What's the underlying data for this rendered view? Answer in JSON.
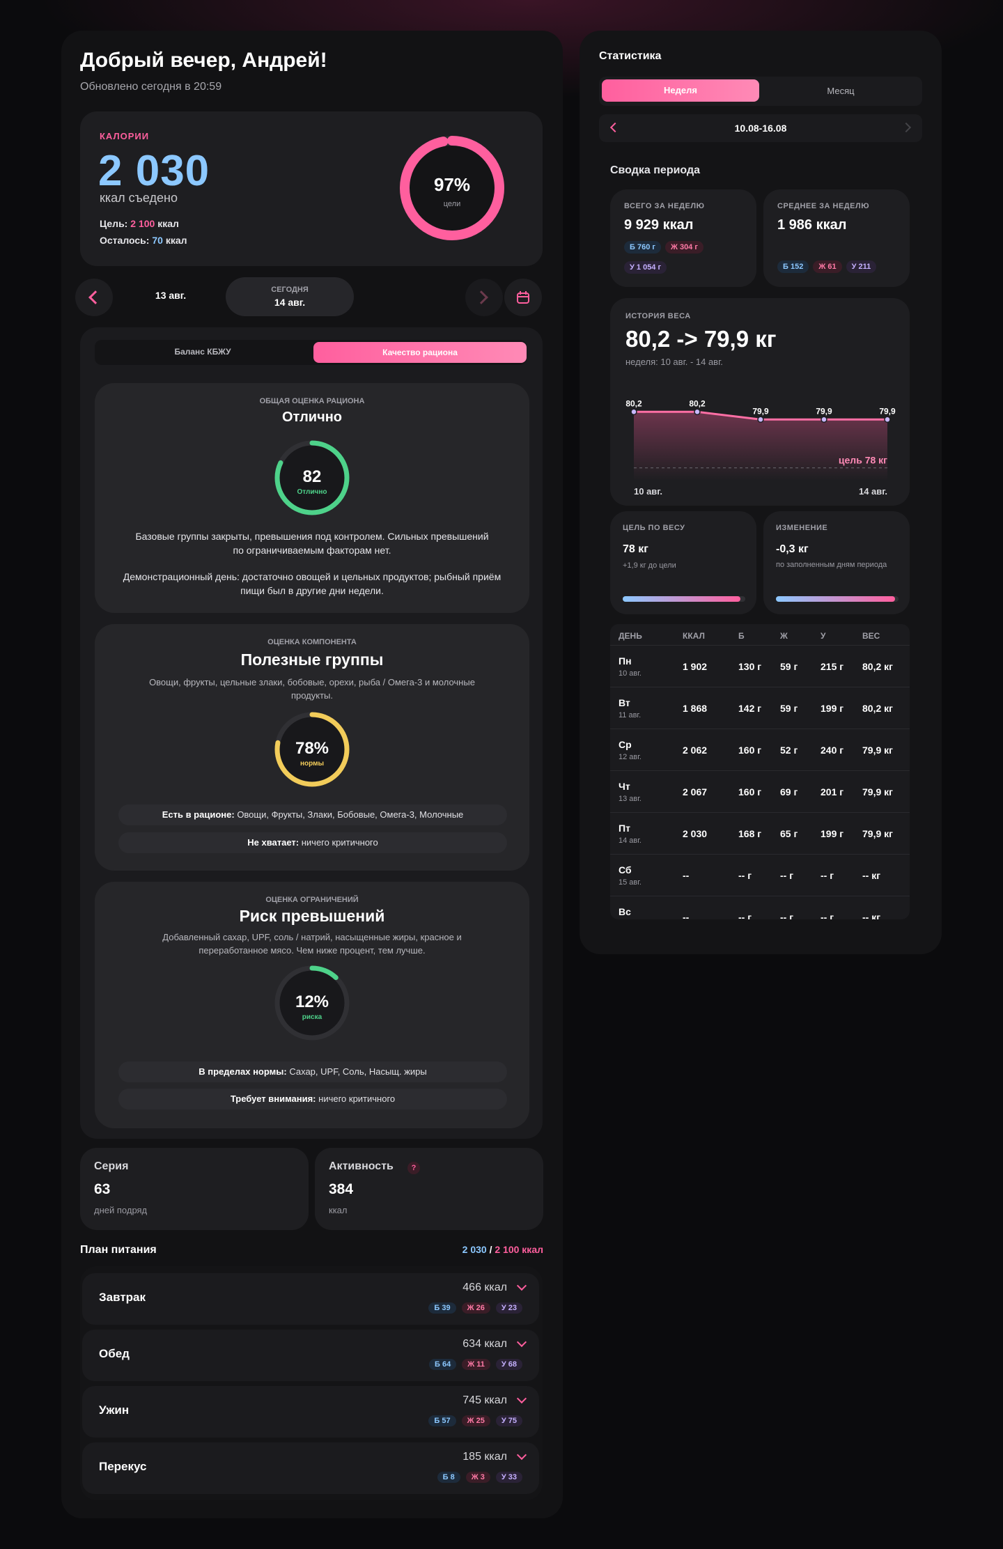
{
  "greeting": {
    "title": "Добрый вечер, Андрей!",
    "updated": "Обновлено сегодня в 20:59"
  },
  "calories": {
    "label": "КАЛОРИИ",
    "value": "2 030",
    "unit": "ккал съедено",
    "goal_label": "Цель:",
    "goal_value": "2 100",
    "goal_unit": "ккал",
    "left_label": "Осталось:",
    "left_value": "70",
    "left_unit": "ккал",
    "ring_percent": "97%",
    "ring_sub": "цели",
    "ring_progress": 0.97
  },
  "datenav": {
    "prev_date": "13 авг.",
    "today_label": "СЕГОДНЯ",
    "today_date": "14 авг."
  },
  "tabs": {
    "balance": "Баланс КБЖУ",
    "quality": "Качество рациона"
  },
  "overall": {
    "caption": "ОБЩАЯ ОЦЕНКА РАЦИОНА",
    "title": "Отлично",
    "score": "82",
    "score_label": "Отлично",
    "progress": 0.82,
    "text1": "Базовые группы закрыты, превышения под контролем. Сильных превышений по ограничиваемым факторам нет.",
    "text2": "Демонстрационный день: достаточно овощей и цельных продуктов; рыбный приём пищи был в другие дни недели."
  },
  "useful": {
    "caption": "ОЦЕНКА КОМПОНЕНТА",
    "title": "Полезные группы",
    "desc": "Овощи, фрукты, цельные злаки, бобовые, орехи, рыба / Омега-3 и молочные продукты.",
    "percent": "78%",
    "percent_label": "нормы",
    "progress": 0.78,
    "present_label": "Есть в рационе:",
    "present_value": "Овощи, Фрукты, Злаки, Бобовые, Омега-3, Молочные",
    "missing_label": "Не хватает:",
    "missing_value": "ничего критичного"
  },
  "risk": {
    "caption": "ОЦЕНКА ОГРАНИЧЕНИЙ",
    "title": "Риск превышений",
    "desc": "Добавленный сахар, UPF, соль / натрий, насыщенные жиры, красное и переработанное мясо. Чем ниже процент, тем лучше.",
    "percent": "12%",
    "percent_label": "риска",
    "progress": 0.12,
    "ok_label": "В пределах нормы:",
    "ok_value": "Сахар, UPF, Соль, Насыщ. жиры",
    "attn_label": "Требует внимания:",
    "attn_value": "ничего критичного"
  },
  "streak": {
    "label": "Серия",
    "value": "63",
    "sub": "дней подряд"
  },
  "activity": {
    "label": "Активность",
    "help": "?",
    "value": "384",
    "sub": "ккал"
  },
  "plan": {
    "title": "План питания",
    "eaten": "2 030",
    "sep": " / ",
    "goal": "2 100 ккал",
    "meals": [
      {
        "name": "Завтрак",
        "kcal": "466 ккал",
        "b": "Б 39",
        "zh": "Ж 26",
        "u": "У 23"
      },
      {
        "name": "Обед",
        "kcal": "634 ккал",
        "b": "Б 64",
        "zh": "Ж 11",
        "u": "У 68"
      },
      {
        "name": "Ужин",
        "kcal": "745 ккал",
        "b": "Б 57",
        "zh": "Ж 25",
        "u": "У 75"
      },
      {
        "name": "Перекус",
        "kcal": "185 ккал",
        "b": "Б 8",
        "zh": "Ж 3",
        "u": "У 33"
      }
    ]
  },
  "stats": {
    "title": "Статистика",
    "tab_week": "Неделя",
    "tab_month": "Месяц",
    "range": "10.08-16.08",
    "summary_title": "Сводка периода",
    "total_label": "ВСЕГО ЗА НЕДЕЛЮ",
    "total_value": "9 929 ккал",
    "total_b": "Б 760 г",
    "total_zh": "Ж 304 г",
    "total_u": "У 1 054 г",
    "avg_label": "СРЕДНЕЕ ЗА НЕДЕЛЮ",
    "avg_value": "1 986 ккал",
    "avg_b": "Б 152",
    "avg_zh": "Ж 61",
    "avg_u": "У 211",
    "weight_label": "ИСТОРИЯ ВЕСА",
    "weight_value": "80,2 -> 79,9 кг",
    "weight_sub": "неделя: 10 авг. - 14 авг.",
    "goal_weight_label": "ЦЕЛЬ ПО ВЕСУ",
    "goal_weight_value": "78 кг",
    "goal_weight_sub": "+1,9 кг до цели",
    "goal_weight_progress": 0.96,
    "change_label": "ИЗМЕНЕНИЕ",
    "change_value": "-0,3 кг",
    "change_sub": "по заполненным дням периода",
    "change_progress": 0.97
  },
  "chart_data": {
    "type": "area",
    "x": [
      "10 авг.",
      "11 авг.",
      "12 авг.",
      "13 авг.",
      "14 авг."
    ],
    "values": [
      80.2,
      80.2,
      79.9,
      79.9,
      79.9
    ],
    "labels": [
      "80,2",
      "80,2",
      "79,9",
      "79,9",
      "79,9"
    ],
    "goal": 78,
    "goal_label": "цель 78 кг",
    "x_start_label": "10 авг.",
    "x_end_label": "14 авг.",
    "ylim": [
      77.5,
      80.4
    ]
  },
  "table": {
    "headers": [
      "ДЕНЬ",
      "ККАЛ",
      "Б",
      "Ж",
      "У",
      "ВЕС"
    ],
    "rows": [
      {
        "day": "Пн",
        "date": "10 авг.",
        "kcal": "1 902",
        "b": "130 г",
        "zh": "59 г",
        "u": "215 г",
        "w": "80,2 кг"
      },
      {
        "day": "Вт",
        "date": "11 авг.",
        "kcal": "1 868",
        "b": "142 г",
        "zh": "59 г",
        "u": "199 г",
        "w": "80,2 кг"
      },
      {
        "day": "Ср",
        "date": "12 авг.",
        "kcal": "2 062",
        "b": "160 г",
        "zh": "52 г",
        "u": "240 г",
        "w": "79,9 кг"
      },
      {
        "day": "Чт",
        "date": "13 авг.",
        "kcal": "2 067",
        "b": "160 г",
        "zh": "69 г",
        "u": "201 г",
        "w": "79,9 кг"
      },
      {
        "day": "Пт",
        "date": "14 авг.",
        "kcal": "2 030",
        "b": "168 г",
        "zh": "65 г",
        "u": "199 г",
        "w": "79,9 кг"
      },
      {
        "day": "Сб",
        "date": "15 авг.",
        "kcal": "--",
        "b": "-- г",
        "zh": "-- г",
        "u": "-- г",
        "w": "-- кг"
      },
      {
        "day": "Вс",
        "date": "",
        "kcal": "--",
        "b": "-- г",
        "zh": "-- г",
        "u": "-- г",
        "w": "-- кг"
      }
    ]
  },
  "colors": {
    "accent": "#ff5f9e",
    "blue": "#8cc8ff",
    "green": "#4ed28a",
    "yellow": "#f2cc5a"
  }
}
